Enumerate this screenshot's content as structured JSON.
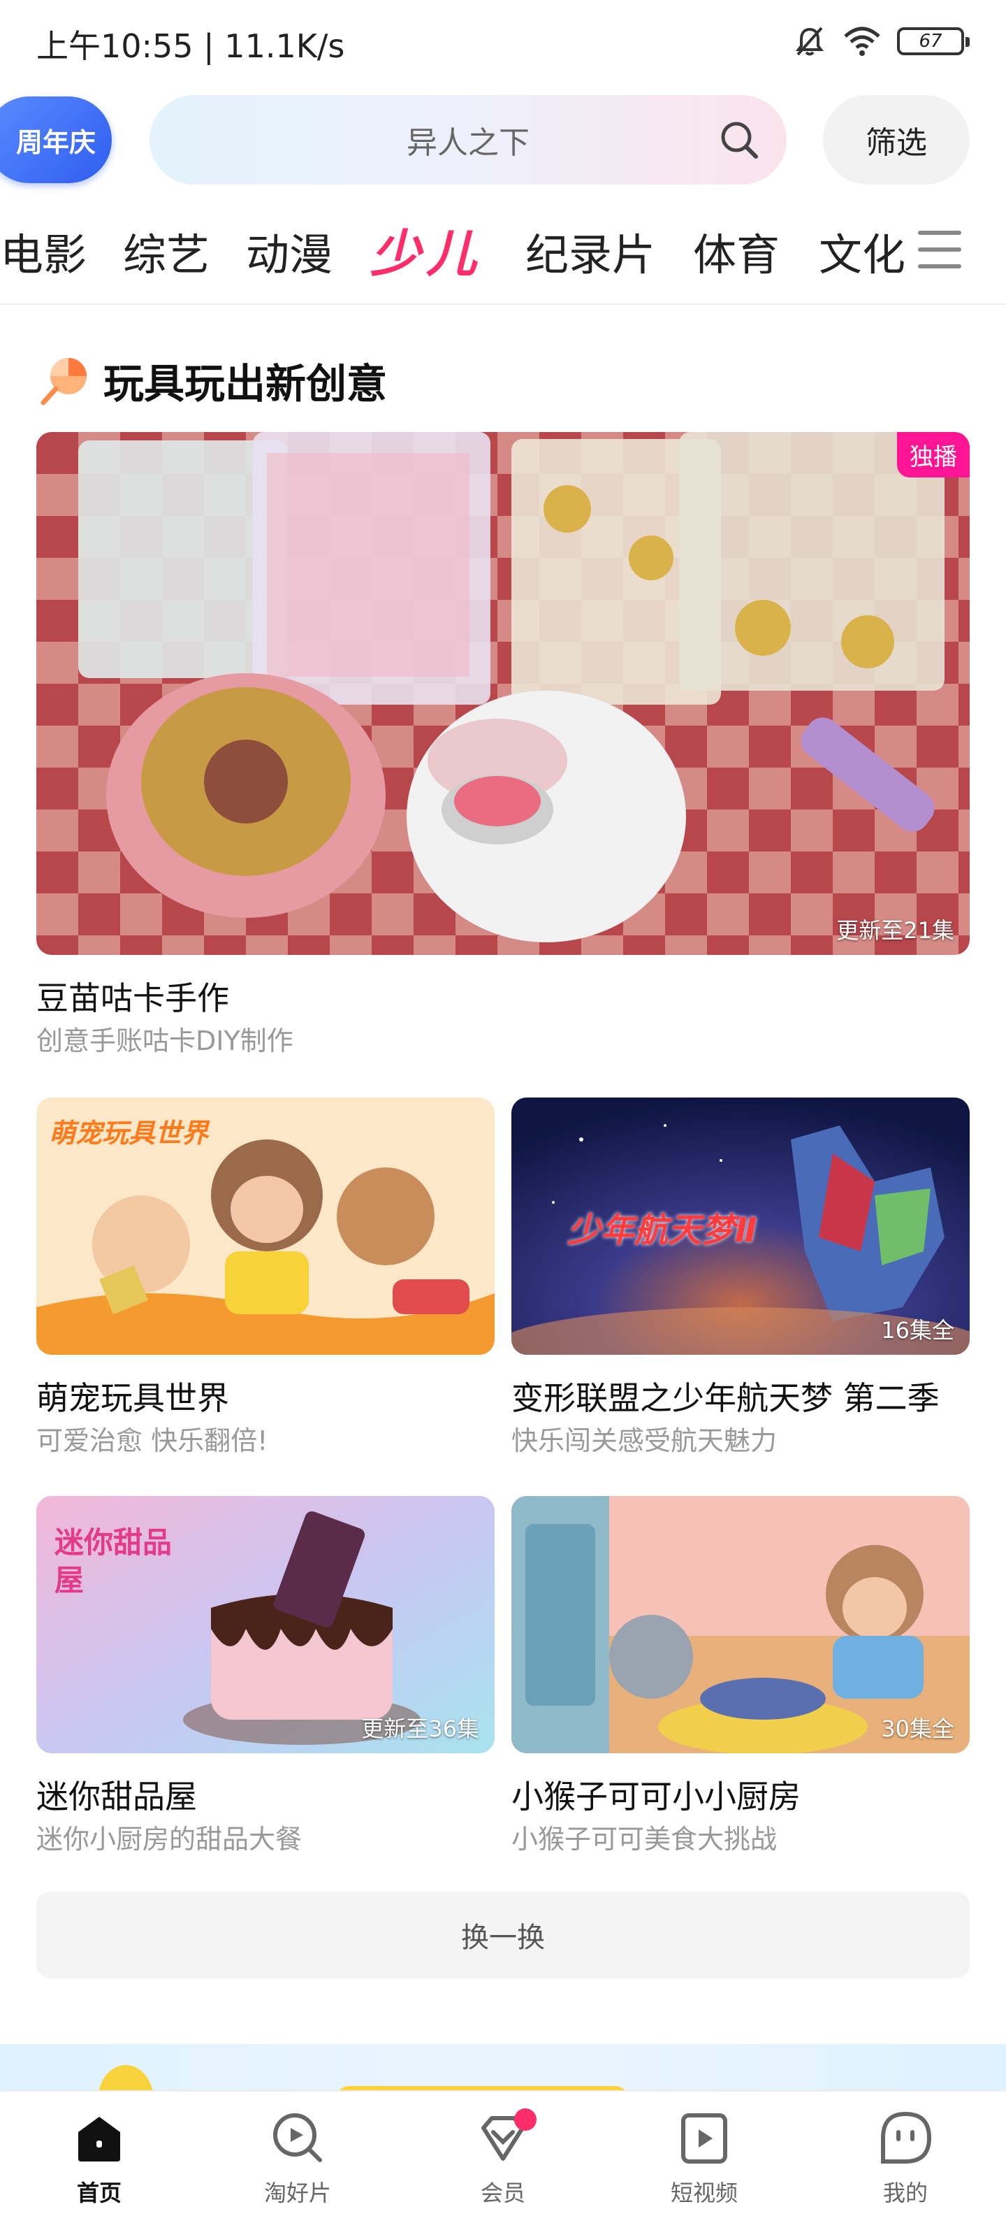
{
  "status_bar": {
    "time": "上午10:55 | 11.1K/s",
    "battery": "67"
  },
  "header": {
    "anniversary_badge": "周年庆",
    "search_placeholder": "异人之下",
    "filter_label": "筛选"
  },
  "category_tabs": [
    {
      "label": "电影",
      "active": false
    },
    {
      "label": "综艺",
      "active": false
    },
    {
      "label": "动漫",
      "active": false
    },
    {
      "label": "少儿",
      "active": true
    },
    {
      "label": "纪录片",
      "active": false
    },
    {
      "label": "体育",
      "active": false
    },
    {
      "label": "文化",
      "active": false
    }
  ],
  "section": {
    "title": "玩具玩出新创意"
  },
  "featured": {
    "title": "豆苗咕卡手作",
    "subtitle": "创意手账咕卡DIY制作",
    "tag": "独播",
    "episode": "更新至21集"
  },
  "grid": [
    {
      "title": "萌宠玩具世界",
      "subtitle": "可爱治愈 快乐翻倍!",
      "episode": "",
      "thumb_text": "萌宠玩具世界"
    },
    {
      "title": "变形联盟之少年航天梦 第二季",
      "subtitle": "快乐闯关感受航天魅力",
      "episode": "16集全",
      "thumb_text": "少年航天梦Ⅱ"
    },
    {
      "title": "迷你甜品屋",
      "subtitle": "迷你小厨房的甜品大餐",
      "episode": "更新至36集",
      "thumb_text": "迷你甜品屋"
    },
    {
      "title": "小猴子可可小小厨房",
      "subtitle": "小猴子可可美食大挑战",
      "episode": "30集全",
      "thumb_text": ""
    }
  ],
  "refresh_label": "换一换",
  "bottom_nav": [
    {
      "label": "首页",
      "icon": "home-icon",
      "active": true
    },
    {
      "label": "淘好片",
      "icon": "discover-icon",
      "active": false
    },
    {
      "label": "会员",
      "icon": "vip-diamond-icon",
      "active": false
    },
    {
      "label": "短视频",
      "icon": "short-video-icon",
      "active": false
    },
    {
      "label": "我的",
      "icon": "profile-icon",
      "active": false
    }
  ],
  "colors": {
    "accent": "#ff2e6a",
    "tag_pink": "#ff1493",
    "badge_blue": "#2f5df0"
  }
}
